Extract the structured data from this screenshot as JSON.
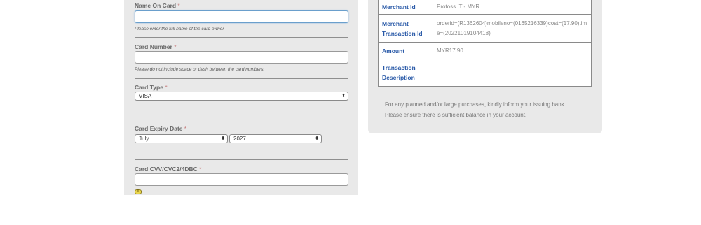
{
  "form": {
    "name_on_card": {
      "label": "Name On Card",
      "required_mark": "*",
      "value": "",
      "hint": "Please enter the full name of the card owner"
    },
    "card_number": {
      "label": "Card Number",
      "required_mark": "*",
      "value": "",
      "hint": "Please do not include space or dash between the card numbers."
    },
    "card_type": {
      "label": "Card Type",
      "required_mark": "*",
      "selected": "VISA"
    },
    "card_expiry": {
      "label": "Card Expiry Date",
      "required_mark": "*",
      "month": "July",
      "year": "2027"
    },
    "cvv": {
      "label": "Card CVV/CVC2/4DBC",
      "required_mark": "*",
      "value": ""
    },
    "select_arrows": "⬍",
    "info_icon_glyph": "i"
  },
  "summary": {
    "rows": [
      {
        "key": "Merchant Id",
        "value": "Protoss IT - MYR"
      },
      {
        "key": "Merchant Transaction Id",
        "value": "orderid=(R1362604)mobileno=(0165216339)cost=(17.90)time=(20221019104418)"
      },
      {
        "key": "Amount",
        "value": "MYR17.90"
      },
      {
        "key": "Transaction Description",
        "value": ""
      }
    ],
    "note_line1": "For any planned and/or large purchases, kindly inform your issuing bank.",
    "note_line2": "Please ensure there is sufficient balance in your account."
  }
}
